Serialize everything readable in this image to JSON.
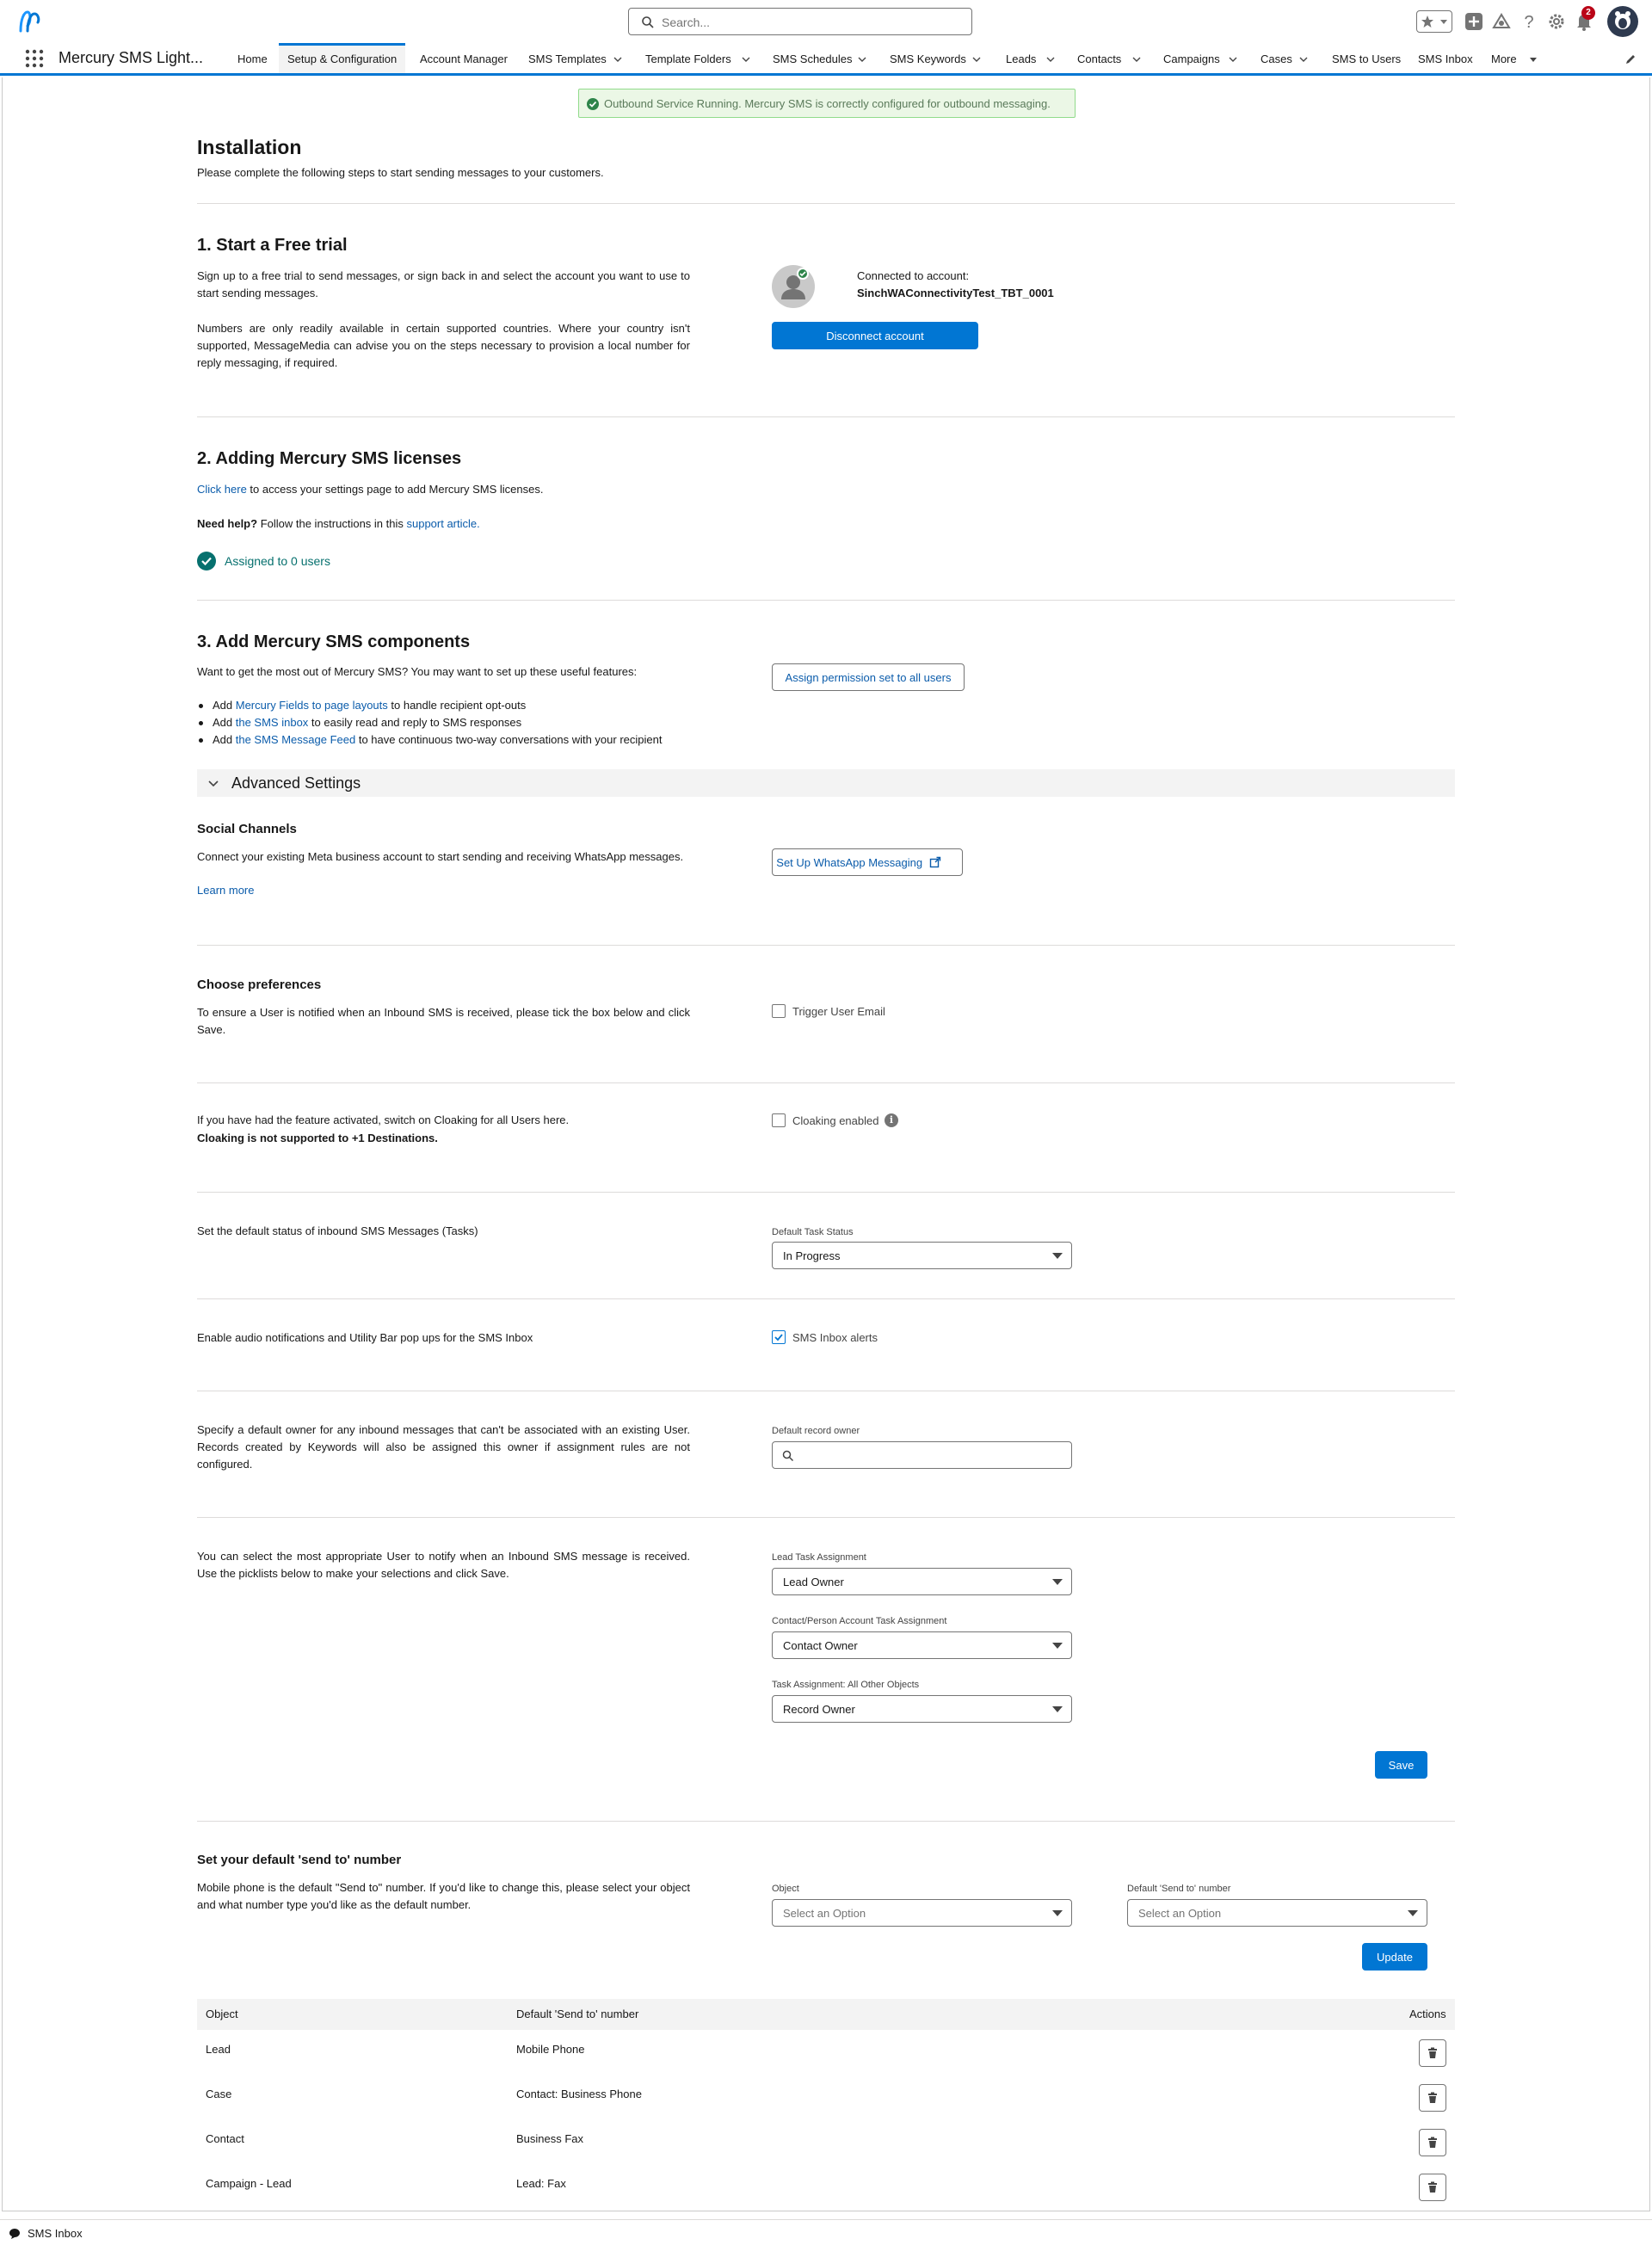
{
  "header": {
    "search_placeholder": "Search...",
    "notification_count": "2"
  },
  "nav": {
    "app_name": "Mercury SMS Light...",
    "items": [
      {
        "label": "Home"
      },
      {
        "label": "Setup & Configuration"
      },
      {
        "label": "Account Manager"
      },
      {
        "label": "SMS Templates"
      },
      {
        "label": "Template Folders"
      },
      {
        "label": "SMS Schedules"
      },
      {
        "label": "SMS Keywords"
      },
      {
        "label": "Leads"
      },
      {
        "label": "Contacts"
      },
      {
        "label": "Campaigns"
      },
      {
        "label": "Cases"
      },
      {
        "label": "SMS to Users"
      },
      {
        "label": "SMS Inbox"
      },
      {
        "label": "More"
      }
    ]
  },
  "status_banner": "Outbound Service Running. Mercury SMS is correctly configured for outbound messaging.",
  "installation": {
    "title": "Installation",
    "subtitle": "Please complete the following steps to start sending messages to your customers."
  },
  "step1": {
    "title": "1. Start a Free trial",
    "para1": "Sign up to a free trial to send messages, or sign back in and select the account you want to use to start sending messages.",
    "para2": "Numbers are only readily available in certain supported countries. Where your country isn't supported, MessageMedia can advise you on the steps necessary to provision a local number for reply messaging, if required.",
    "connected_label": "Connected to account:",
    "account_name": "SinchWAConnectivityTest_TBT_0001",
    "disconnect_button": "Disconnect account"
  },
  "step2": {
    "title": "2. Adding Mercury SMS licenses",
    "click_here": "Click here",
    "click_here_rest": " to access your settings page to add Mercury SMS licenses.",
    "need_help": "Need help?",
    "need_help_rest": " Follow the instructions in this ",
    "support_article": "support article.",
    "assigned": "Assigned to 0 users"
  },
  "step3": {
    "title": "3. Add Mercury SMS components",
    "intro": "Want to get the most out of Mercury SMS? You may want to set up these useful features:",
    "assign_button": "Assign permission set to all users",
    "bullets": [
      {
        "pre": "Add ",
        "link": "Mercury Fields to page layouts",
        "post": " to handle recipient opt-outs"
      },
      {
        "pre": "Add ",
        "link": "the SMS inbox",
        "post": " to easily read and reply to SMS responses"
      },
      {
        "pre": "Add ",
        "link": "the SMS Message Feed",
        "post": " to have continuous two-way conversations with your recipient"
      }
    ]
  },
  "advanced": {
    "title": "Advanced Settings",
    "social": {
      "title": "Social Channels",
      "text": "Connect your existing Meta business account to start sending and receiving WhatsApp messages.",
      "learn_more": "Learn more",
      "button": "Set Up WhatsApp Messaging"
    },
    "preferences": {
      "title": "Choose preferences",
      "text": "To ensure a User is notified when an Inbound SMS is received, please tick the box below and click Save.",
      "trigger_email": "Trigger User Email",
      "trigger_email_checked": false
    },
    "cloaking": {
      "text1": "If you have had the feature activated, switch on Cloaking for all Users here.",
      "text2": "Cloaking is not supported to +1 Destinations.",
      "label": "Cloaking enabled",
      "checked": false
    },
    "task_status": {
      "text": "Set the default status of inbound SMS Messages (Tasks)",
      "label": "Default Task Status",
      "value": "In Progress"
    },
    "audio": {
      "text": "Enable audio notifications and Utility Bar pop ups for the SMS Inbox",
      "label": "SMS Inbox alerts",
      "checked": true
    },
    "default_owner": {
      "text": "Specify a default owner for any inbound messages that can't be associated with an existing User. Records created by Keywords will also be assigned this owner if assignment rules are not configured.",
      "label": "Default record owner",
      "value": ""
    },
    "assignment": {
      "text": "You can select the most appropriate User to notify when an Inbound SMS message is received. Use the picklists below to make your selections and click Save.",
      "lead_label": "Lead Task Assignment",
      "lead_value": "Lead Owner",
      "contact_label": "Contact/Person Account Task Assignment",
      "contact_value": "Contact Owner",
      "other_label": "Task Assignment: All Other Objects",
      "other_value": "Record Owner",
      "save_button": "Save"
    }
  },
  "send_to": {
    "title": "Set your default 'send to' number",
    "text": "Mobile phone is the default \"Send to\" number. If you'd like to change this, please select your object and what number type you'd like as the default number.",
    "object_label": "Object",
    "object_placeholder": "Select an Option",
    "number_label": "Default 'Send to' number",
    "number_placeholder": "Select an Option",
    "update_button": "Update",
    "table": {
      "headers": [
        "Object",
        "Default 'Send to' number",
        "Actions"
      ],
      "rows": [
        {
          "object": "Lead",
          "number": "Mobile Phone"
        },
        {
          "object": "Case",
          "number": "Contact: Business Phone"
        },
        {
          "object": "Contact",
          "number": "Business Fax"
        },
        {
          "object": "Campaign - Lead",
          "number": "Lead: Fax"
        }
      ]
    }
  },
  "utility_bar": {
    "label": "SMS Inbox"
  },
  "colors": {
    "brand": "#0176d3",
    "link": "#0b5cab",
    "success": "#2e844a",
    "teal": "#06706e"
  }
}
